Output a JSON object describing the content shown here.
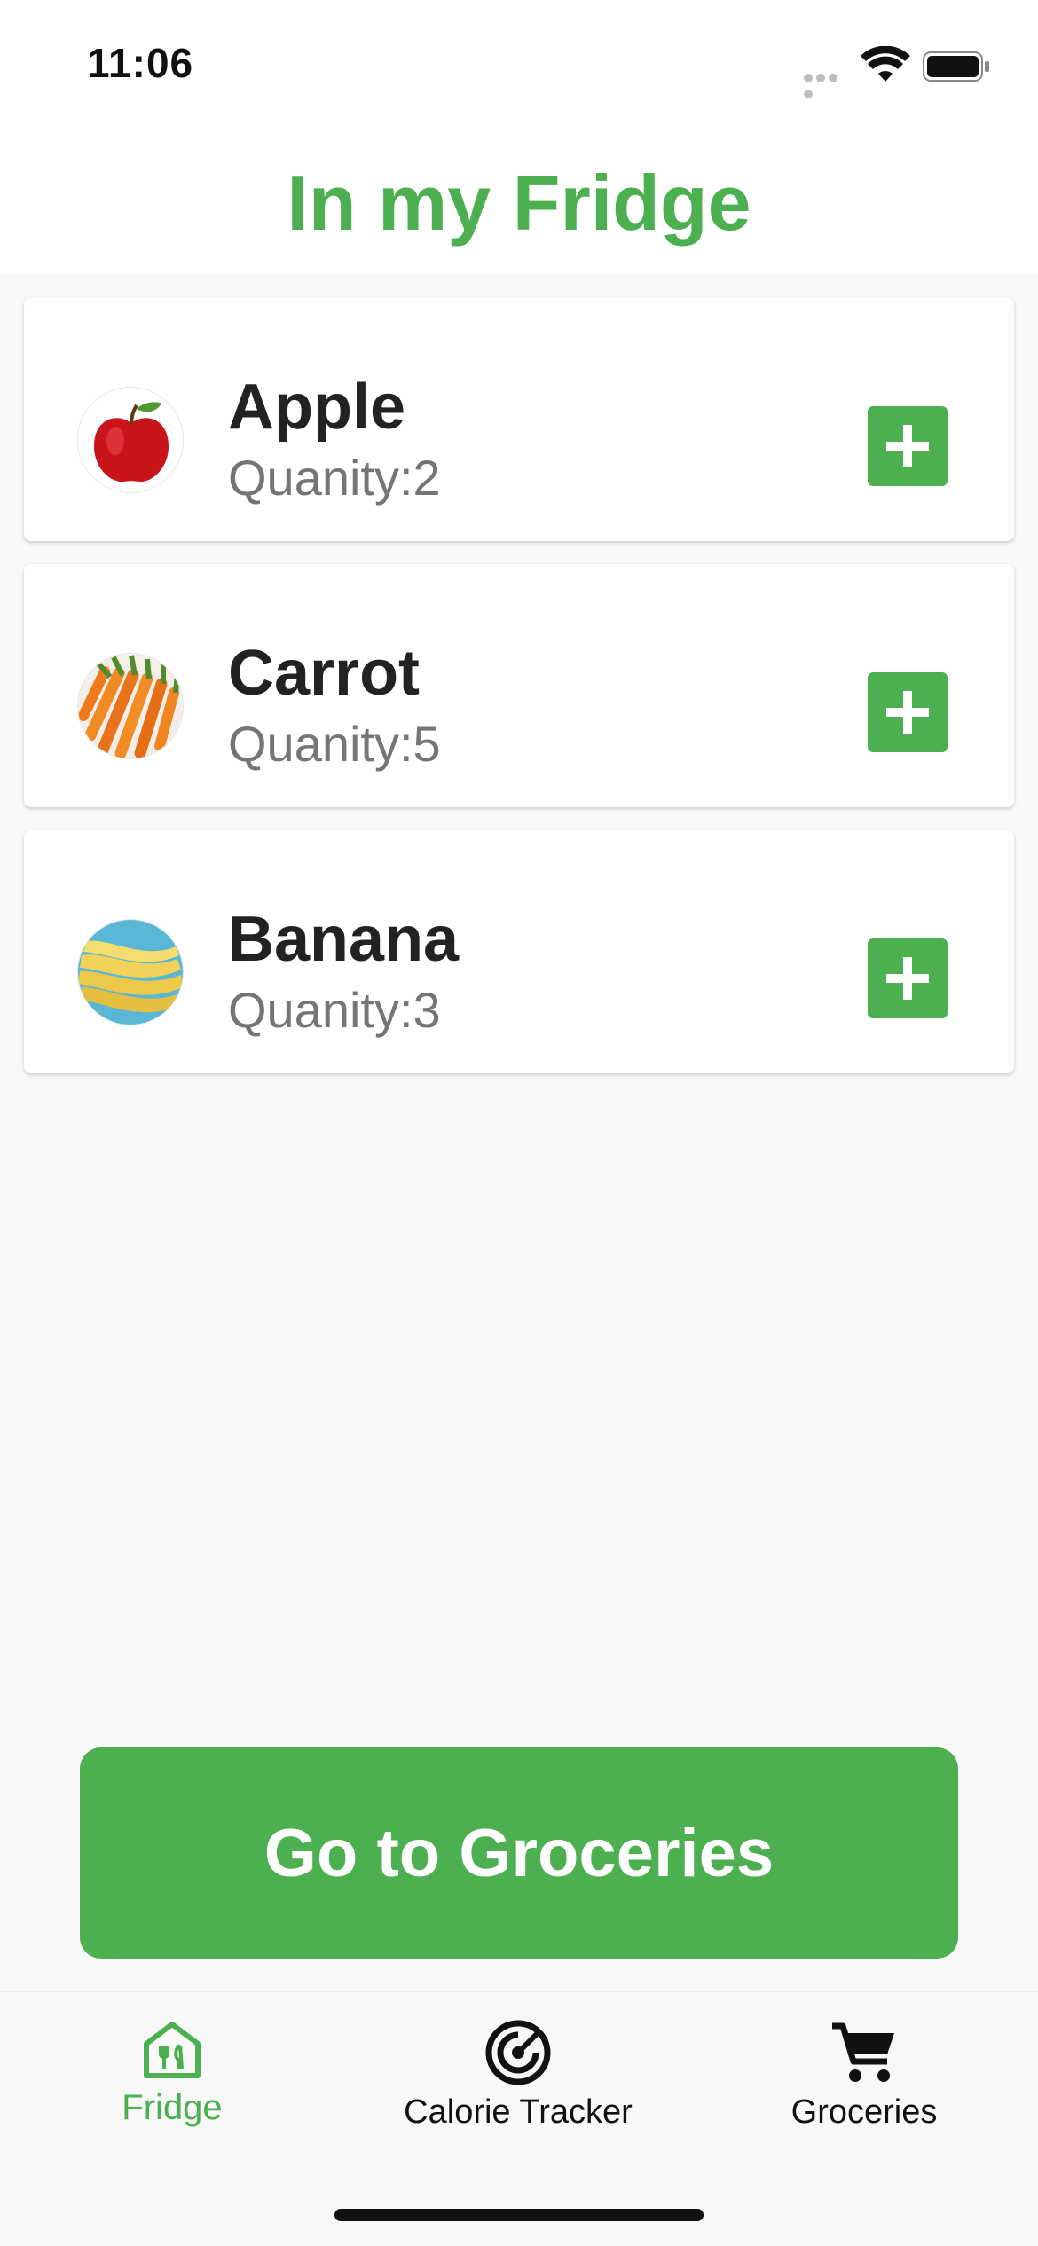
{
  "status_bar": {
    "time": "11:06"
  },
  "header": {
    "title": "In my Fridge"
  },
  "items": [
    {
      "name": "Apple",
      "quantity": "Quanity:2",
      "icon": "apple-icon"
    },
    {
      "name": "Carrot",
      "quantity": "Quanity:5",
      "icon": "carrot-icon"
    },
    {
      "name": "Banana",
      "quantity": "Quanity:3",
      "icon": "banana-icon"
    }
  ],
  "cta": {
    "label": "Go to Groceries"
  },
  "bottom_nav": {
    "items": [
      {
        "label": "Fridge",
        "icon": "fridge-home-icon",
        "active": true
      },
      {
        "label": "Calorie Tracker",
        "icon": "radar-icon",
        "active": false
      },
      {
        "label": "Groceries",
        "icon": "cart-icon",
        "active": false
      }
    ]
  },
  "colors": {
    "accent": "#4caf50",
    "text": "#222222",
    "muted": "#757575",
    "background": "#f8f8f8"
  }
}
